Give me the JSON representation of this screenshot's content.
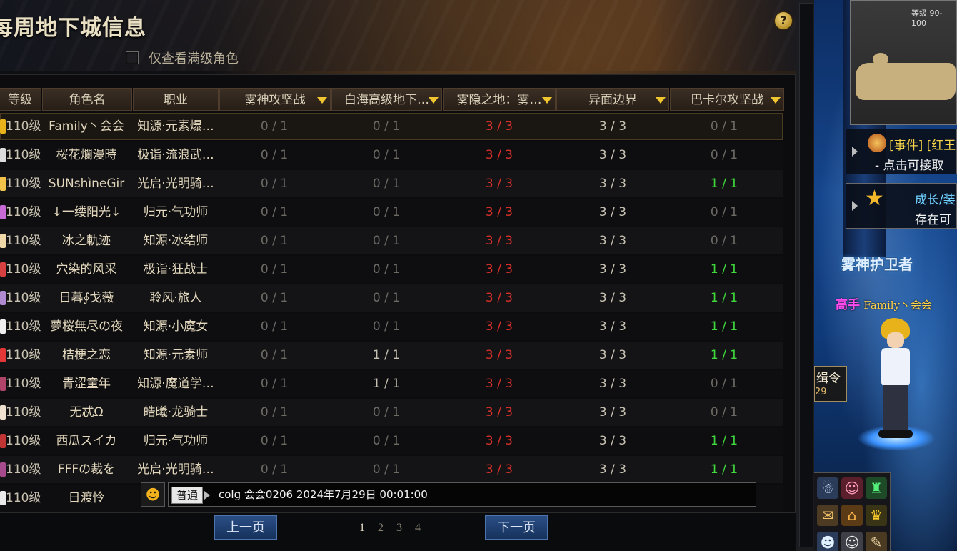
{
  "panel": {
    "title": "每周地下城信息",
    "help_label": "?",
    "filter_label": "仅查看满级角色"
  },
  "table": {
    "headers": [
      "等级",
      "角色名",
      "职业",
      "雾神攻坚战",
      "白海高级地下…",
      "雾隐之地：雾…",
      "异面边界",
      "巴卡尔攻坚战"
    ],
    "rows": [
      {
        "level": "110级",
        "name": "Family丶会会",
        "job": "知源·元素爆…",
        "d1": "0 / 1",
        "d2": "0 / 1",
        "d3": "3 / 3",
        "d4": "3 / 3",
        "d5": "0 / 1",
        "selected": true,
        "av": "#e8b21b"
      },
      {
        "level": "110级",
        "name": "桜花爛漫時",
        "job": "极诣·流浪武…",
        "d1": "0 / 1",
        "d2": "0 / 1",
        "d3": "3 / 3",
        "d4": "3 / 3",
        "d5": "0 / 1",
        "av": "#dcdcdc"
      },
      {
        "level": "110级",
        "name": "SUNshìneGir",
        "job": "光启·光明骑…",
        "d1": "0 / 1",
        "d2": "0 / 1",
        "d3": "3 / 3",
        "d4": "3 / 3",
        "d5": "1 / 1",
        "av": "#f2c24a"
      },
      {
        "level": "110级",
        "name": "↓一缕阳光↓",
        "job": "归元·气功师",
        "d1": "0 / 1",
        "d2": "0 / 1",
        "d3": "3 / 3",
        "d4": "3 / 3",
        "d5": "0 / 1",
        "av": "#c86ad6"
      },
      {
        "level": "110级",
        "name": "冰之軌迹",
        "job": "知源·冰结师",
        "d1": "0 / 1",
        "d2": "0 / 1",
        "d3": "3 / 3",
        "d4": "3 / 3",
        "d5": "0 / 1",
        "av": "#f0d9a8"
      },
      {
        "level": "110级",
        "name": "穴染的风采",
        "job": "极诣·狂战士",
        "d1": "0 / 1",
        "d2": "0 / 1",
        "d3": "3 / 3",
        "d4": "3 / 3",
        "d5": "1 / 1",
        "av": "#d64040"
      },
      {
        "level": "110级",
        "name": "日暮∮戈薇",
        "job": "聆风·旅人",
        "d1": "0 / 1",
        "d2": "0 / 1",
        "d3": "3 / 3",
        "d4": "3 / 3",
        "d5": "1 / 1",
        "av": "#b08ad0"
      },
      {
        "level": "110级",
        "name": "夢桜無尽の夜",
        "job": "知源·小魔女",
        "d1": "0 / 1",
        "d2": "0 / 1",
        "d3": "3 / 3",
        "d4": "3 / 3",
        "d5": "1 / 1",
        "av": "#eeeeee"
      },
      {
        "level": "110级",
        "name": "桔梗之恋",
        "job": "知源·元素师",
        "d1": "0 / 1",
        "d2": "1 / 1",
        "d3": "3 / 3",
        "d4": "3 / 3",
        "d5": "1 / 1",
        "av": "#e43838"
      },
      {
        "level": "110级",
        "name": "青涩童年",
        "job": "知源·魔道学…",
        "d1": "0 / 1",
        "d2": "1 / 1",
        "d3": "3 / 3",
        "d4": "3 / 3",
        "d5": "0 / 1",
        "av": "#b04468"
      },
      {
        "level": "110级",
        "name": "无忒Ω",
        "job": "皓曦·龙骑士",
        "d1": "0 / 1",
        "d2": "0 / 1",
        "d3": "3 / 3",
        "d4": "3 / 3",
        "d5": "0 / 1",
        "av": "#f0e2d0"
      },
      {
        "level": "110级",
        "name": "西瓜スイカ",
        "job": "归元·气功师",
        "d1": "0 / 1",
        "d2": "0 / 1",
        "d3": "3 / 3",
        "d4": "3 / 3",
        "d5": "1 / 1",
        "av": "#c03434"
      },
      {
        "level": "110级",
        "name": "FFFの裁を",
        "job": "光启·光明骑…",
        "d1": "0 / 1",
        "d2": "0 / 1",
        "d3": "3 / 3",
        "d4": "3 / 3",
        "d5": "1 / 1",
        "av": "#a84b8c"
      },
      {
        "level": "110级",
        "name": "日渡怜",
        "job": "",
        "d1": "",
        "d2": "",
        "d3": "",
        "d4": "",
        "d5": "",
        "av": "#e9e9e9"
      }
    ]
  },
  "chat": {
    "emoji": "☻",
    "channel": "普通",
    "text": "colg 会会0206 2024年7月29日 00:01:00"
  },
  "pagination": {
    "prev_label": "上一页",
    "next_label": "下一页",
    "pages": [
      "1",
      "2",
      "3",
      "4"
    ],
    "current_page": "1"
  },
  "game": {
    "minimap_level": "等级 90-100",
    "event_title": "[事件] [红王",
    "event_sub": "- 点击可接取",
    "growth_title": "成长/装",
    "growth_sub": "存在可",
    "area_title": "雾神护卫者",
    "player_rank": "高手",
    "player_name": "Family丶会会",
    "quest_label": "缉令",
    "quest_num": "29",
    "colors": {
      "accent_gold": "#f0c630",
      "red": "#d8302a",
      "green": "#3fd93c",
      "button_blue": "#1f3f70"
    }
  }
}
